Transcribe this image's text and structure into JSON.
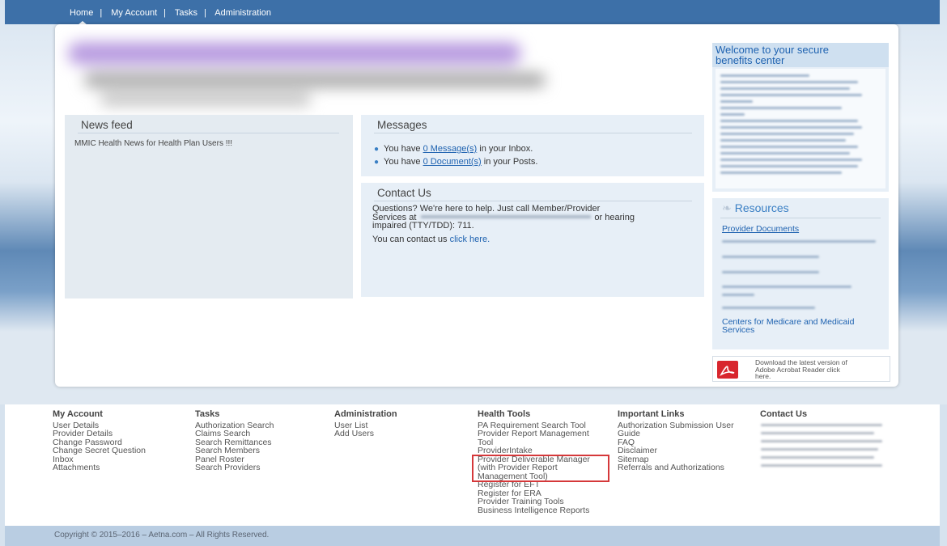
{
  "nav": {
    "items": [
      "Home",
      "My Account",
      "Tasks",
      "Administration"
    ],
    "active": "Home"
  },
  "news": {
    "title": "News feed",
    "item": "MMIC Health News for Health Plan Users !!!"
  },
  "messages": {
    "title": "Messages",
    "inbox_prefix": "You have ",
    "inbox_link": "0 Message(s)",
    "inbox_suffix": " in your Inbox.",
    "posts_prefix": "You have ",
    "posts_link": "0 Document(s)",
    "posts_suffix": " in your Posts."
  },
  "contact": {
    "title": "Contact Us",
    "line1": "Questions? We're here to help. Just call Member/Provider",
    "line2_prefix": "Services at",
    "line2_suffix": "or hearing",
    "line3": "impaired (TTY/TDD): 711.",
    "click_prefix": "You can contact us ",
    "click_link": "click here."
  },
  "welcome": {
    "title_line1": "Welcome to your secure",
    "title_line2": "benefits center"
  },
  "resources": {
    "title": "Resources",
    "provider_documents": "Provider Documents",
    "cms_line1": "Centers for Medicare and Medicaid",
    "cms_line2": "Services"
  },
  "adobe": {
    "line1": "Download the latest version of",
    "line2": "Adobe Acrobat Reader click",
    "line3": "here."
  },
  "footer": {
    "my_account": {
      "heading": "My Account",
      "items": [
        "User Details",
        "Provider Details",
        "Change Password",
        "Change Secret Question",
        "Inbox",
        "Attachments"
      ]
    },
    "tasks": {
      "heading": "Tasks",
      "items": [
        "Authorization Search",
        "Claims Search",
        "Search Remittances",
        "Search Members",
        "Panel Roster",
        "Search Providers"
      ]
    },
    "administration": {
      "heading": "Administration",
      "items": [
        "User List",
        "Add Users"
      ]
    },
    "health_tools": {
      "heading": "Health Tools",
      "items": [
        "PA Requirement Search Tool",
        "Provider Report Management",
        "Tool",
        "ProviderIntake",
        "Provider Deliverable Manager",
        "(with Provider Report",
        "Management Tool)",
        "Register for EFT",
        "Register for ERA",
        "Provider Training Tools",
        "Business Intelligence Reports"
      ]
    },
    "important_links": {
      "heading": "Important Links",
      "items": [
        "Authorization Submission User",
        "Guide",
        "FAQ",
        "Disclaimer",
        "Sitemap",
        "Referrals and Authorizations"
      ]
    },
    "contact_us": {
      "heading": "Contact Us"
    },
    "copyright": "Copyright © 2015–2016 – Aetna.com – All Rights Reserved."
  }
}
